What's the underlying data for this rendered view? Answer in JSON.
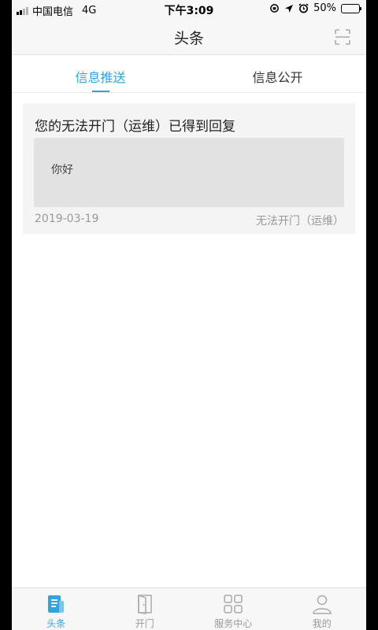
{
  "status_bar": {
    "carrier": "中国电信",
    "network": "4G",
    "time": "下午3:09",
    "battery": "50%",
    "battery_level": 0.5
  },
  "header": {
    "title": "头条",
    "right_icon": "scan-icon"
  },
  "tabs": [
    {
      "label": "信息推送",
      "active": true
    },
    {
      "label": "信息公开",
      "active": false
    }
  ],
  "messages": [
    {
      "title": "您的无法开门（运维）已得到回复",
      "reply": "你好",
      "date": "2019-03-19",
      "category": "无法开门（运维）"
    }
  ],
  "bottom_nav": [
    {
      "label": "头条",
      "icon": "news-icon",
      "active": true
    },
    {
      "label": "开门",
      "icon": "door-icon",
      "active": false
    },
    {
      "label": "服务中心",
      "icon": "grid-icon",
      "active": false
    },
    {
      "label": "我的",
      "icon": "user-icon",
      "active": false
    }
  ],
  "colors": {
    "accent": "#33a3dc",
    "muted": "#999999"
  }
}
